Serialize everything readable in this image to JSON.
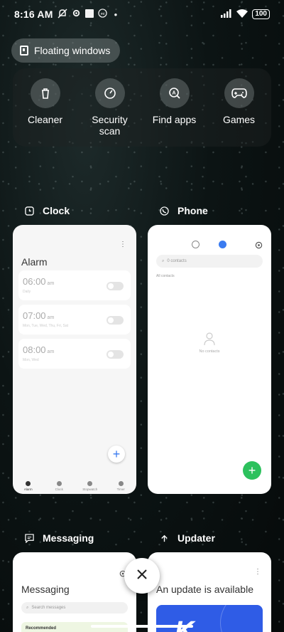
{
  "status_bar": {
    "time": "8:16 AM",
    "left_icons": [
      "mute-icon",
      "settings-icon",
      "square-icon",
      "mi-icon",
      "dot-icon"
    ],
    "right_icons": [
      "signal-icon",
      "wifi-icon"
    ],
    "battery": "100"
  },
  "floating_windows": {
    "label": "Floating windows"
  },
  "tools": [
    {
      "icon": "trash-icon",
      "label": "Cleaner"
    },
    {
      "icon": "gauge-icon",
      "label": "Security scan"
    },
    {
      "icon": "search-a-icon",
      "label": "Find apps"
    },
    {
      "icon": "gamepad-icon",
      "label": "Games"
    }
  ],
  "apps": {
    "clock": {
      "name": "Clock",
      "screen_title": "Alarm",
      "alarms": [
        {
          "time": "06:00",
          "period": "am",
          "sub": "Daily"
        },
        {
          "time": "07:00",
          "period": "am",
          "sub": "Mon, Tue, Wed, Thu, Fri, Sat"
        },
        {
          "time": "08:00",
          "period": "am",
          "sub": "Mon, Wed"
        }
      ],
      "nav": [
        "Alarm",
        "Clock",
        "Stopwatch",
        "Timer"
      ],
      "add_label": "+"
    },
    "phone": {
      "name": "Phone",
      "search_placeholder": "0 contacts",
      "all_contacts": "All contacts",
      "empty_text": "No contacts",
      "add_label": "+"
    },
    "messaging": {
      "name": "Messaging",
      "screen_title": "Messaging",
      "search_placeholder": "Search messages",
      "recommended": "Recommended"
    },
    "updater": {
      "name": "Updater",
      "screen_title": "An update is available",
      "banner_letter": "K"
    }
  },
  "colors": {
    "accent_blue": "#3a7bf0",
    "fab_green": "#2cc15d",
    "banner_blue": "#2f5ce6"
  }
}
